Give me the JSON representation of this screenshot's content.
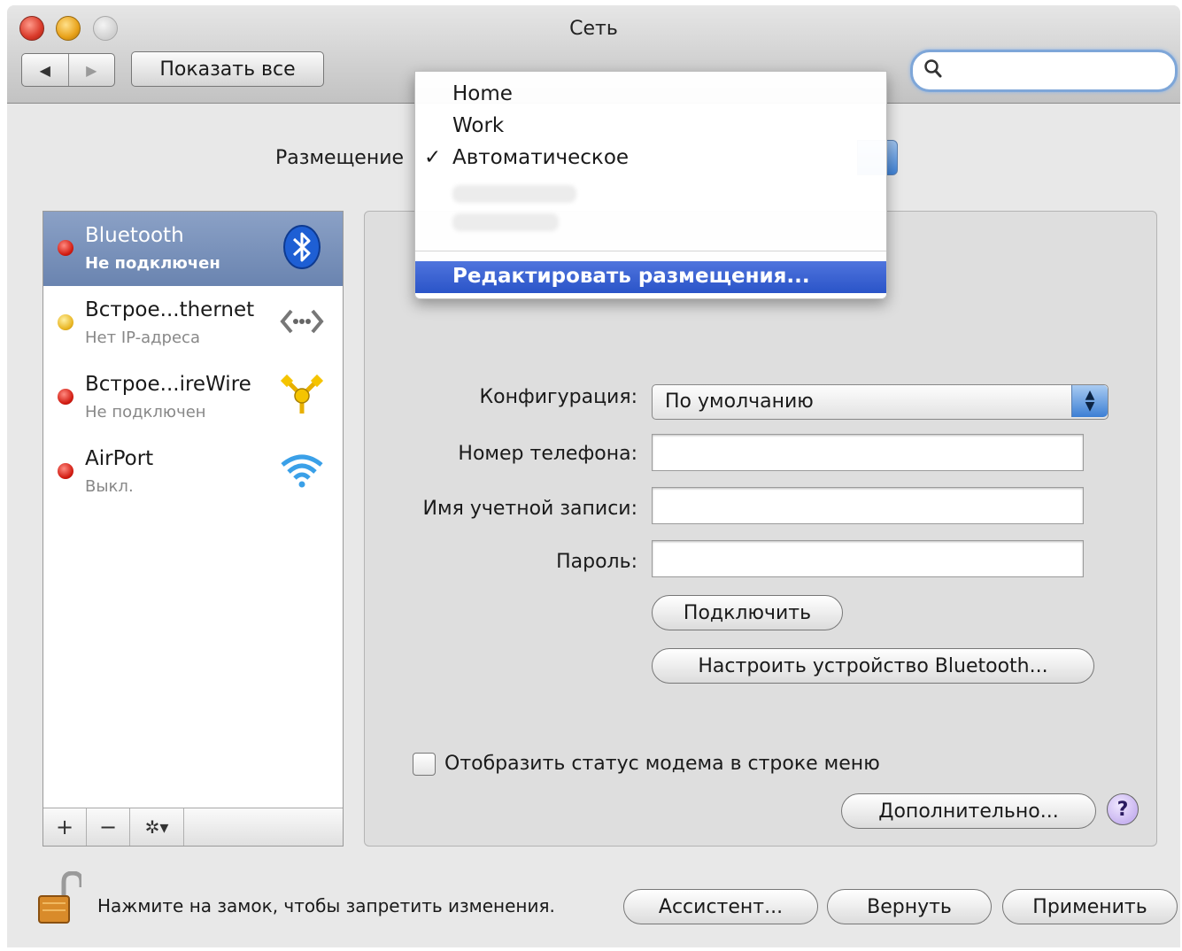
{
  "window": {
    "title": "Сеть"
  },
  "toolbar": {
    "back_symbol": "◀",
    "forward_symbol": "▶",
    "show_all_label": "Показать все",
    "search_placeholder": "",
    "search_icon": "magnifier-icon"
  },
  "location": {
    "label": "Размещение",
    "menu": {
      "items": [
        {
          "label": "Home",
          "checked": false
        },
        {
          "label": "Work",
          "checked": false
        },
        {
          "label": "Автоматическое",
          "checked": true
        }
      ],
      "check_mark": "✓",
      "edit_label": "Редактировать размещения..."
    }
  },
  "services": [
    {
      "name": "Bluetooth",
      "status": "Не подключен",
      "status_color": "red",
      "icon": "bluetooth-icon",
      "selected": true
    },
    {
      "name": "Встрое...thernet",
      "status": "Нет IP-адреса",
      "status_color": "yellow",
      "icon": "ethernet-icon",
      "selected": false
    },
    {
      "name": "Встрое...ireWire",
      "status": "Не подключен",
      "status_color": "red",
      "icon": "firewire-icon",
      "selected": false
    },
    {
      "name": "AirPort",
      "status": "Выкл.",
      "status_color": "red",
      "icon": "wifi-icon",
      "selected": false
    }
  ],
  "sidebar_footer": {
    "add": "+",
    "remove": "−",
    "gear": "✲▾"
  },
  "form": {
    "config_label": "Конфигурация:",
    "config_value": "По умолчанию",
    "phone_label": "Номер телефона:",
    "phone_value": "",
    "account_label": "Имя учетной записи:",
    "account_value": "",
    "password_label": "Пароль:",
    "password_value": "",
    "connect_label": "Подключить",
    "setup_bt_label": "Настроить устройство Bluetooth...",
    "show_modem_label": "Отобразить статус модема в строке меню",
    "show_modem_checked": false,
    "advanced_label": "Дополнительно...",
    "help_label": "?"
  },
  "bottom": {
    "lock_text": "Нажмите на замок, чтобы запретить изменения.",
    "assistant_label": "Ассистент...",
    "revert_label": "Вернуть",
    "apply_label": "Применить"
  },
  "colors": {
    "selected_row": "#7a91bb",
    "menu_highlight": "#2f5acb",
    "status_red": "#d11a10",
    "status_yellow": "#e8b420"
  }
}
